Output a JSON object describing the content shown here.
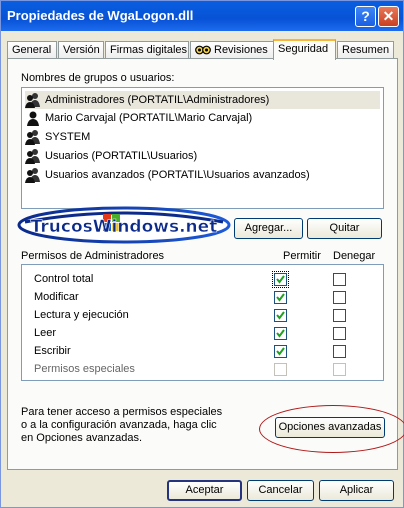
{
  "window": {
    "title": "Propiedades de WgaLogon.dll",
    "help_glyph": "?",
    "close_glyph": "✕"
  },
  "tabs": [
    {
      "label": "General"
    },
    {
      "label": "Versión"
    },
    {
      "label": "Firmas digitales"
    },
    {
      "label": "Revisiones"
    },
    {
      "label": "Seguridad"
    },
    {
      "label": "Resumen"
    }
  ],
  "groups": {
    "heading": "Nombres de grupos o usuarios:",
    "items": [
      {
        "label": "Administradores (PORTATIL\\Administradores)",
        "icon": "users-icon"
      },
      {
        "label": "Mario Carvajal (PORTATIL\\Mario Carvajal)",
        "icon": "user-icon"
      },
      {
        "label": "SYSTEM",
        "icon": "users-icon"
      },
      {
        "label": "Usuarios (PORTATIL\\Usuarios)",
        "icon": "users-icon"
      },
      {
        "label": "Usuarios avanzados (PORTATIL\\Usuarios avanzados)",
        "icon": "users-icon"
      }
    ]
  },
  "buttons": {
    "add": "Agregar...",
    "remove": "Quitar",
    "advanced": "Opciones avanzadas",
    "ok": "Aceptar",
    "cancel": "Cancelar",
    "apply": "Aplicar"
  },
  "watermark": "TrucosWindows.net",
  "permissions": {
    "heading": "Permisos de Administradores",
    "allow_label": "Permitir",
    "deny_label": "Denegar",
    "rows": [
      {
        "label": "Control total",
        "allow": true,
        "deny": false,
        "disabled": false
      },
      {
        "label": "Modificar",
        "allow": true,
        "deny": false,
        "disabled": false
      },
      {
        "label": "Lectura y ejecución",
        "allow": true,
        "deny": false,
        "disabled": false
      },
      {
        "label": "Leer",
        "allow": true,
        "deny": false,
        "disabled": false
      },
      {
        "label": "Escribir",
        "allow": true,
        "deny": false,
        "disabled": false
      },
      {
        "label": "Permisos especiales",
        "allow": false,
        "deny": false,
        "disabled": true
      }
    ]
  },
  "advanced_info": {
    "line1": "Para tener acceso a permisos especiales",
    "line2": "o a la configuración avanzada, haga clic",
    "line3": "en Opciones avanzadas."
  },
  "colors": {
    "titlebar": "#0752d6",
    "highlight_ellipse": "#b01818",
    "tab_accent": "#f7b53b"
  }
}
